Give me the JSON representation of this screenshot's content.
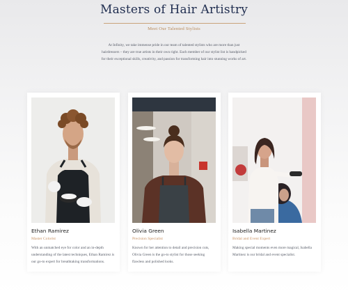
{
  "section": {
    "title": "Masters of Hair Artistry",
    "subtitle": "Meet Our Talented Stylists",
    "intro": "At Infinity, we take immense pride in our team of talented stylists who are more than just hairdressers – they are true artists in their own right. Each member of our stylist list is handpicked for their exceptional skills, creativity, and passion for transforming hair into stunning works of art."
  },
  "stylists": [
    {
      "name": "Ethan Ramirez",
      "role": "Master Colorist",
      "bio": "With an unmatched eye for color and an in-depth understanding of the latest techniques, Ethan Ramirez is our go-to expert for breathtaking transformations."
    },
    {
      "name": "Olivia Green",
      "role": "Precision Specialist",
      "bio": "Known for her attention to detail and precision cuts, Olivia Green is the go-to stylist for those seeking flawless and polished looks."
    },
    {
      "name": "Isabella Martinez",
      "role": "Bridal and Event Expert",
      "bio": "Making special moments even more magical, Isabella Martinez is our bridal and event specialist."
    }
  ],
  "colors": {
    "title": "#1f2d4f",
    "accent": "#c79060",
    "body_text": "#555a66"
  }
}
